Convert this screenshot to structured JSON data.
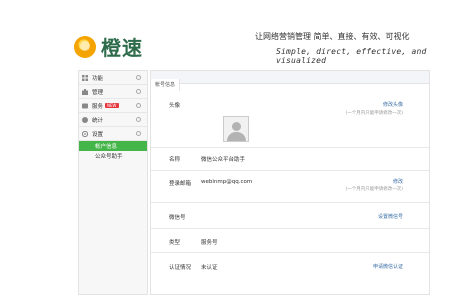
{
  "header": {
    "logo_text": "橙速",
    "slogan_cn": "让网络营销管理 简单、直接、有效、可视化",
    "slogan_en": "Simple, direct, effective, and visualized"
  },
  "sidebar": {
    "items": [
      {
        "label": "功能",
        "icon": "grid-icon"
      },
      {
        "label": "管理",
        "icon": "briefcase-icon"
      },
      {
        "label": "服务",
        "icon": "service-icon",
        "badge": "NEW"
      },
      {
        "label": "统计",
        "icon": "chart-icon"
      },
      {
        "label": "设置",
        "icon": "gear-icon"
      }
    ],
    "sub_items": [
      {
        "label": "帐户信息",
        "active": true
      },
      {
        "label": "公众号助手",
        "active": false
      }
    ]
  },
  "main": {
    "tab": "帐号信息",
    "rows": {
      "avatar": {
        "label": "头像",
        "link": "修改头像",
        "hint": "(一个月内只能申请修改一次)"
      },
      "name": {
        "label": "名称",
        "value": "微信公众平台助手"
      },
      "email": {
        "label": "登录邮箱",
        "value": "webinmp@qq.com",
        "link": "修改",
        "hint": "(一个月内只能申请修改一次)"
      },
      "wechat_id": {
        "label": "微信号",
        "link": "设置微信号"
      },
      "type": {
        "label": "类型",
        "value": "服务号"
      },
      "verify": {
        "label": "认证情况",
        "value": "未认证",
        "link": "申请微信认证"
      }
    }
  },
  "colors": {
    "accent": "#44b549",
    "link": "#3a6ea5",
    "badge": "#e5343a",
    "brand": "#f5a300"
  }
}
